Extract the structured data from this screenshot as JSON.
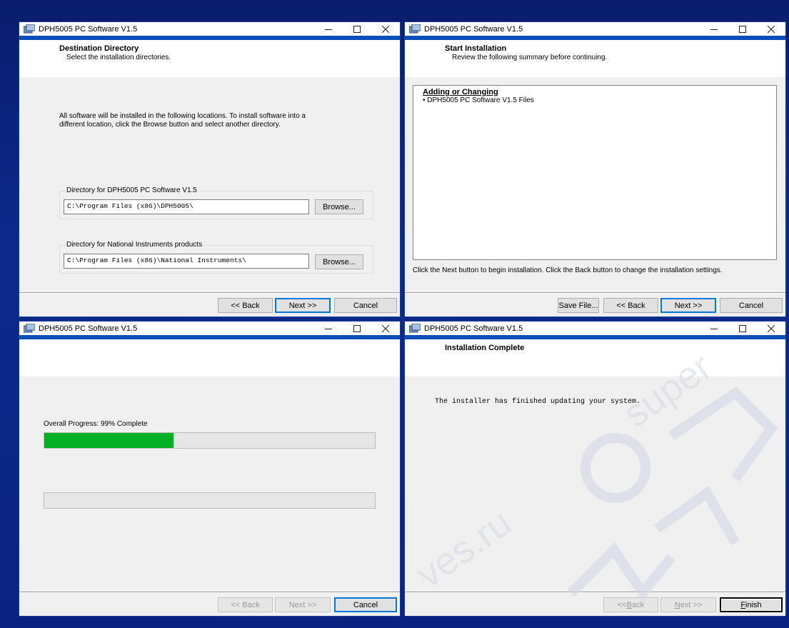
{
  "windows": {
    "w1": {
      "title": "DPH5005 PC Software V1.5",
      "header_title": "Destination Directory",
      "header_subtitle": "Select the installation directories.",
      "description": "All software will be installed in the following locations. To install software into a different location, click the Browse button and select another directory.",
      "group1_label": "Directory for DPH5005 PC Software V1.5",
      "group1_path": "C:\\Program Files (x86)\\DPH5005\\",
      "group1_browse": "Browse...",
      "group2_label": "Directory for National Instruments products",
      "group2_path": "C:\\Program Files (x86)\\National Instruments\\",
      "group2_browse": "Browse...",
      "back": "<< Back",
      "next": "Next >>",
      "cancel": "Cancel"
    },
    "w2": {
      "title": "DPH5005 PC Software V1.5",
      "header_title": "Start Installation",
      "header_subtitle": "Review the following summary before continuing.",
      "summary_heading": "Adding or Changing",
      "summary_item": "• DPH5005 PC Software V1.5 Files",
      "note": "Click the Next button to begin installation.  Click the Back button to change the installation settings.",
      "save_file": "Save File...",
      "back": "<< Back",
      "next": "Next >>",
      "cancel": "Cancel"
    },
    "w3": {
      "title": "DPH5005 PC Software V1.5",
      "progress_label": "Overall Progress: 99% Complete",
      "overall_progress": 0.39,
      "secondary_progress": 0,
      "back": "<< Back",
      "next": "Next >>",
      "cancel": "Cancel"
    },
    "w4": {
      "title": "DPH5005 PC Software V1.5",
      "header_title": "Installation Complete",
      "message": "The installer has finished updating your system.",
      "back_prefix": "<< ",
      "back_u": "B",
      "back_rest": "ack",
      "next_prefix": "",
      "next_u": "N",
      "next_rest": "ext >>",
      "finish_u": "F",
      "finish_rest": "inish"
    }
  },
  "colors": {
    "desktop": "#0b2a8c",
    "title_accent": "#0b4fb8",
    "progress_fill": "#06b025",
    "default_button_border": "#0078d7"
  },
  "watermark": {
    "text1": "super",
    "text2": "ves.ru"
  }
}
